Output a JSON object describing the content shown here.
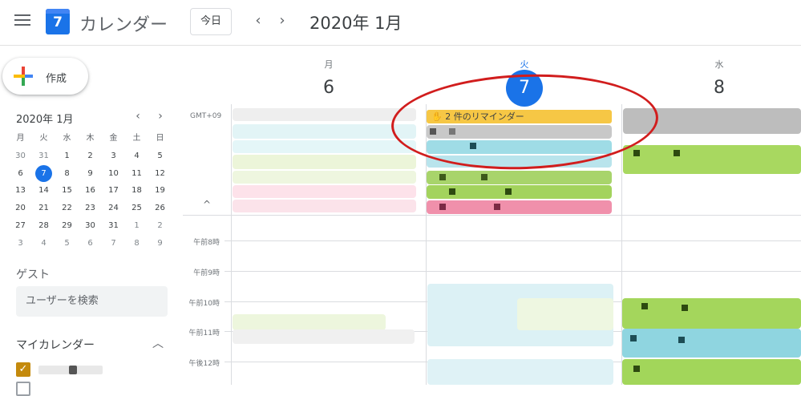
{
  "header": {
    "app_title": "カレンダー",
    "logo_day": "7",
    "today_button": "今日",
    "prev_icon": "‹",
    "next_icon": "›",
    "current_period": "2020年 1月"
  },
  "sidebar": {
    "create_label": "作成",
    "mini_calendar": {
      "title": "2020年 1月",
      "weekdays": [
        "月",
        "火",
        "水",
        "木",
        "金",
        "土",
        "日"
      ],
      "weeks": [
        [
          "30",
          "31",
          "1",
          "2",
          "3",
          "4",
          "5"
        ],
        [
          "6",
          "7",
          "8",
          "9",
          "10",
          "11",
          "12"
        ],
        [
          "13",
          "14",
          "15",
          "16",
          "17",
          "18",
          "19"
        ],
        [
          "20",
          "21",
          "22",
          "23",
          "24",
          "25",
          "26"
        ],
        [
          "27",
          "28",
          "29",
          "30",
          "31",
          "1",
          "2"
        ],
        [
          "3",
          "4",
          "5",
          "6",
          "7",
          "8",
          "9"
        ]
      ],
      "selected": "7"
    },
    "guest_title": "ゲスト",
    "guest_search_placeholder": "ユーザーを検索",
    "my_calendars_title": "マイカレンダー",
    "my_calendar_color": "#c48a0d"
  },
  "grid": {
    "timezone": "GMT+09",
    "days": [
      {
        "weekday": "月",
        "date": "6"
      },
      {
        "weekday": "火",
        "date": "7",
        "today": true
      },
      {
        "weekday": "水",
        "date": "8"
      }
    ],
    "reminder_label": "2 件のリマインダー",
    "time_labels": [
      "午前8時",
      "午前9時",
      "午前10時",
      "午前11時",
      "午後12時"
    ],
    "collapse_icon": "^"
  },
  "colors": {
    "accent": "#1a73e8",
    "annotation_ring": "#d11d1d",
    "reminder": "#f6c745"
  }
}
